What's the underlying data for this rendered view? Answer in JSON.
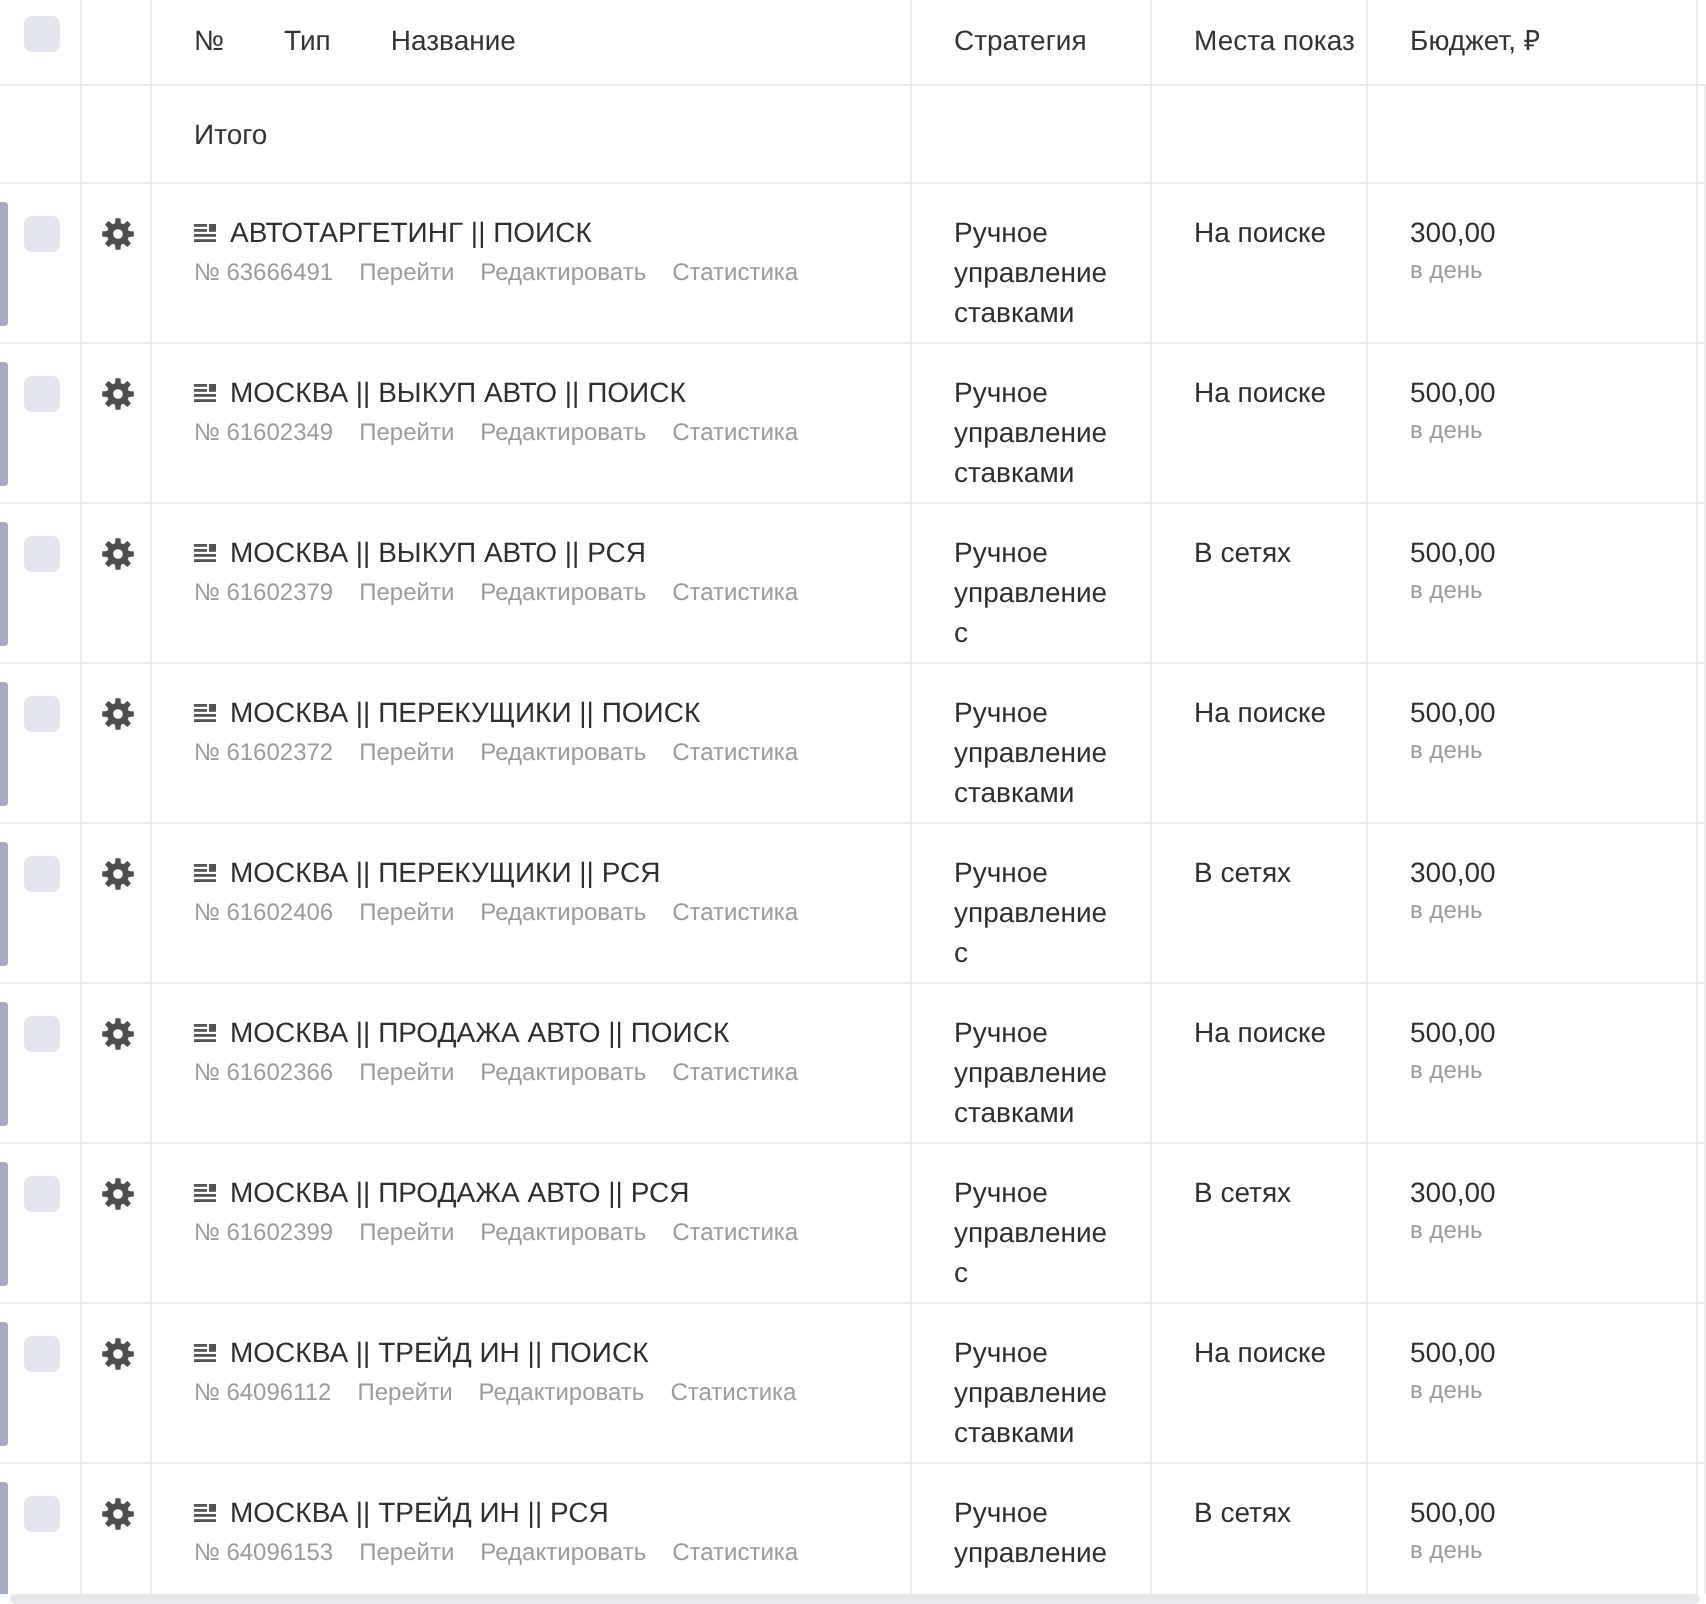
{
  "header": {
    "checkbox": {
      "checked": false
    },
    "name_headings": [
      "№",
      "Тип",
      "Название"
    ],
    "columns": [
      "Стратегия",
      "Места показ",
      "Бюджет, ₽"
    ]
  },
  "totals": {
    "label": "Итого"
  },
  "campaigns": [
    {
      "checked": false,
      "name": "АВТОТАРГЕТИНГ || ПОИСК",
      "number": "№ 63666491",
      "actions": [
        "Перейти",
        "Редактировать",
        "Статистика"
      ],
      "strategy": "Ручное управление ставками",
      "placement": "На поиске",
      "budget": "300,00",
      "budget_period": "в день"
    },
    {
      "checked": false,
      "name": "МОСКВА || ВЫКУП АВТО || ПОИСК",
      "number": "№ 61602349",
      "actions": [
        "Перейти",
        "Редактировать",
        "Статистика"
      ],
      "strategy": "Ручное управление ставками",
      "placement": "На поиске",
      "budget": "500,00",
      "budget_period": "в день"
    },
    {
      "checked": false,
      "name": "МОСКВА || ВЫКУП АВТО || РСЯ",
      "number": "№ 61602379",
      "actions": [
        "Перейти",
        "Редактировать",
        "Статистика"
      ],
      "strategy": "Ручное управление с",
      "placement": "В сетях",
      "budget": "500,00",
      "budget_period": "в день"
    },
    {
      "checked": false,
      "name": "МОСКВА || ПЕРЕКУЩИКИ || ПОИСК",
      "number": "№ 61602372",
      "actions": [
        "Перейти",
        "Редактировать",
        "Статистика"
      ],
      "strategy": "Ручное управление ставками",
      "placement": "На поиске",
      "budget": "500,00",
      "budget_period": "в день"
    },
    {
      "checked": false,
      "name": "МОСКВА || ПЕРЕКУЩИКИ || РСЯ",
      "number": "№ 61602406",
      "actions": [
        "Перейти",
        "Редактировать",
        "Статистика"
      ],
      "strategy": "Ручное управление с",
      "placement": "В сетях",
      "budget": "300,00",
      "budget_period": "в день"
    },
    {
      "checked": false,
      "name": "МОСКВА || ПРОДАЖА АВТО || ПОИСК",
      "number": "№ 61602366",
      "actions": [
        "Перейти",
        "Редактировать",
        "Статистика"
      ],
      "strategy": "Ручное управление ставками",
      "placement": "На поиске",
      "budget": "500,00",
      "budget_period": "в день"
    },
    {
      "checked": false,
      "name": "МОСКВА || ПРОДАЖА АВТО || РСЯ",
      "number": "№ 61602399",
      "actions": [
        "Перейти",
        "Редактировать",
        "Статистика"
      ],
      "strategy": "Ручное управление с",
      "placement": "В сетях",
      "budget": "300,00",
      "budget_period": "в день"
    },
    {
      "checked": false,
      "name": "МОСКВА || ТРЕЙД ИН || ПОИСК",
      "number": "№ 64096112",
      "actions": [
        "Перейти",
        "Редактировать",
        "Статистика"
      ],
      "strategy": "Ручное управление ставками",
      "placement": "На поиске",
      "budget": "500,00",
      "budget_period": "в день"
    },
    {
      "checked": false,
      "name": "МОСКВА || ТРЕЙД ИН || РСЯ",
      "number": "№ 64096153",
      "actions": [
        "Перейти",
        "Редактировать",
        "Статистика"
      ],
      "strategy": "Ручное управление",
      "placement": "В сетях",
      "budget": "500,00",
      "budget_period": "в день"
    }
  ]
}
